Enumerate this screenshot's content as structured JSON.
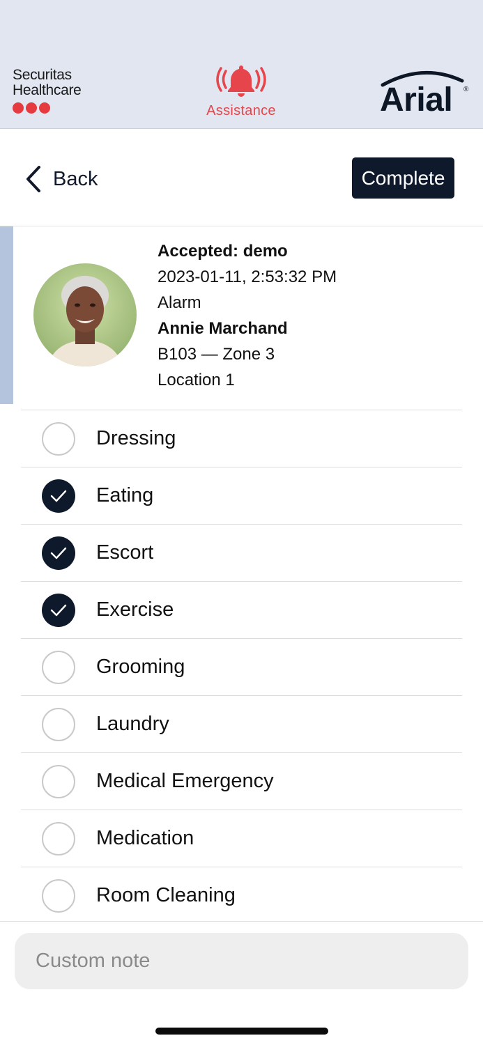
{
  "header": {
    "brand_left_line1": "Securitas",
    "brand_left_line2": "Healthcare",
    "assist_label": "Assistance",
    "brand_right": "Arial",
    "brand_right_mark": "®",
    "colors": {
      "background": "#e1e6f1",
      "alert_red": "#e5454b",
      "dots_red": "#e53a40",
      "navy": "#0e1a2b"
    }
  },
  "nav": {
    "back_label": "Back",
    "complete_label": "Complete"
  },
  "alarm": {
    "accepted": "Accepted: demo",
    "timestamp": "2023-01-11, 2:53:32 PM",
    "type": "Alarm",
    "resident": "Annie Marchand",
    "room": "B103 — Zone 3",
    "location": "Location 1"
  },
  "tasks": [
    {
      "label": "Dressing",
      "checked": false
    },
    {
      "label": "Eating",
      "checked": true
    },
    {
      "label": "Escort",
      "checked": true
    },
    {
      "label": "Exercise",
      "checked": true
    },
    {
      "label": "Grooming",
      "checked": false
    },
    {
      "label": "Laundry",
      "checked": false
    },
    {
      "label": "Medical Emergency",
      "checked": false
    },
    {
      "label": "Medication",
      "checked": false
    },
    {
      "label": "Room Cleaning",
      "checked": false
    }
  ],
  "note": {
    "placeholder": "Custom note",
    "value": ""
  }
}
